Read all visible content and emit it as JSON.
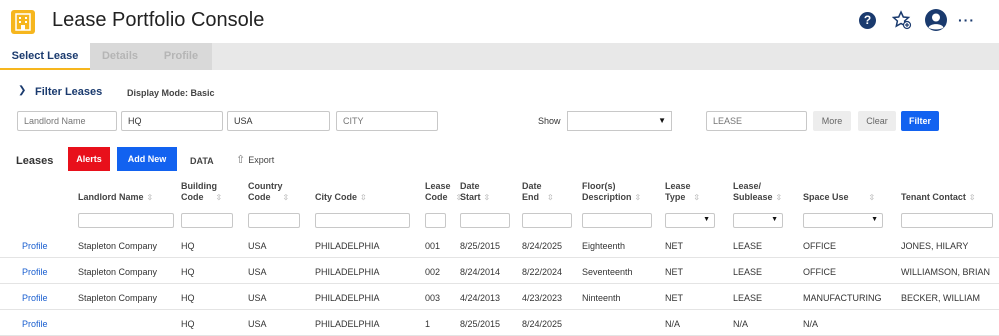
{
  "header": {
    "title": "Lease Portfolio Console",
    "help_glyph": "?",
    "more_glyph": "···",
    "icons": [
      "building-icon",
      "help-icon",
      "favorite-star-icon",
      "user-avatar-icon",
      "more-icon"
    ]
  },
  "tabs": [
    {
      "label": "Select Lease",
      "active": true
    },
    {
      "label": "Details",
      "active": false
    },
    {
      "label": "Profile",
      "active": false
    }
  ],
  "filters": {
    "toggle_label": "Filter Leases",
    "display_mode": "Display Mode: Basic",
    "landlord_placeholder": "Landlord Name",
    "building_value": "HQ",
    "country_value": "USA",
    "city_placeholder": "CITY",
    "show_label": "Show",
    "show_value": "",
    "lease_placeholder": "LEASE",
    "more_label": "More",
    "clear_label": "Clear",
    "filter_label": "Filter"
  },
  "toolbar": {
    "leases_label": "Leases",
    "alerts_label": "Alerts",
    "add_new_label": "Add New",
    "data_label": "DATA",
    "export_label": "Export"
  },
  "table": {
    "columns": [
      {
        "line1": "Landlord Name",
        "line2": ""
      },
      {
        "line1": "Building",
        "line2": "Code"
      },
      {
        "line1": "Country",
        "line2": "Code"
      },
      {
        "line1": "City Code",
        "line2": ""
      },
      {
        "line1": "Lease",
        "line2": "Code"
      },
      {
        "line1": "Date",
        "line2": "Start"
      },
      {
        "line1": "Date",
        "line2": "End"
      },
      {
        "line1": "Floor(s)",
        "line2": "Description"
      },
      {
        "line1": "Lease",
        "line2": "Type"
      },
      {
        "line1": "Lease/",
        "line2": "Sublease"
      },
      {
        "line1": "Space Use",
        "line2": ""
      },
      {
        "line1": "Tenant Contact",
        "line2": ""
      }
    ],
    "sort_glyph": "⇳",
    "rows": [
      {
        "action": "Profile",
        "cells": [
          "Stapleton Company",
          "HQ",
          "USA",
          "PHILADELPHIA",
          "001",
          "8/25/2015",
          "8/24/2025",
          "Eighteenth",
          "NET",
          "LEASE",
          "OFFICE",
          "JONES, HILARY"
        ]
      },
      {
        "action": "Profile",
        "cells": [
          "Stapleton Company",
          "HQ",
          "USA",
          "PHILADELPHIA",
          "002",
          "8/24/2014",
          "8/22/2024",
          "Seventeenth",
          "NET",
          "LEASE",
          "OFFICE",
          "WILLIAMSON, BRIAN"
        ]
      },
      {
        "action": "Profile",
        "cells": [
          "Stapleton Company",
          "HQ",
          "USA",
          "PHILADELPHIA",
          "003",
          "4/24/2013",
          "4/23/2023",
          "Ninteenth",
          "NET",
          "LEASE",
          "MANUFACTURING",
          "BECKER, WILLIAM"
        ]
      },
      {
        "action": "Profile",
        "cells": [
          "",
          "HQ",
          "USA",
          "PHILADELPHIA",
          "1",
          "8/25/2015",
          "8/24/2025",
          "",
          "N/A",
          "N/A",
          "N/A",
          ""
        ]
      }
    ]
  },
  "colors": {
    "accent": "#f6b61e",
    "primary_button": "#1262f0",
    "alert_button": "#e8101b",
    "link": "#1a5fd0",
    "nav_text": "#1a3a6e"
  }
}
